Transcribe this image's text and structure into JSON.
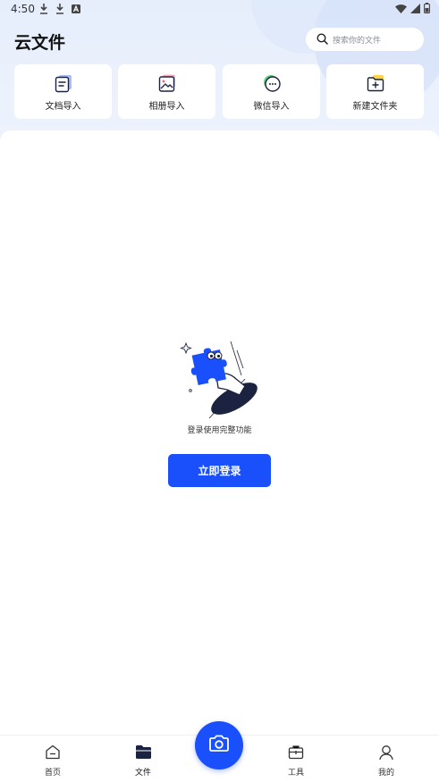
{
  "status_bar": {
    "time": "4:50",
    "left_icons": [
      "download-icon",
      "download-icon",
      "a-icon"
    ],
    "right_icons": [
      "wifi-icon",
      "signal-icon",
      "battery-icon"
    ]
  },
  "header": {
    "title": "云文件",
    "search_placeholder": "搜索你的文件"
  },
  "actions": [
    {
      "label": "文档导入",
      "icon": "document-import-icon"
    },
    {
      "label": "相册导入",
      "icon": "album-import-icon"
    },
    {
      "label": "微信导入",
      "icon": "wechat-import-icon"
    },
    {
      "label": "新建文件夹",
      "icon": "new-folder-icon"
    }
  ],
  "empty_state": {
    "message": "登录使用完整功能",
    "button_label": "立即登录"
  },
  "bottom_nav": {
    "items": [
      {
        "label": "首页",
        "icon": "home-icon"
      },
      {
        "label": "文件",
        "icon": "folder-icon"
      },
      {
        "label": "工具",
        "icon": "toolbox-icon"
      },
      {
        "label": "我的",
        "icon": "user-icon"
      }
    ],
    "center_icon": "camera-icon"
  },
  "colors": {
    "accent": "#1a4ffc",
    "background": "#e9f0fc",
    "panel": "#ffffff"
  }
}
